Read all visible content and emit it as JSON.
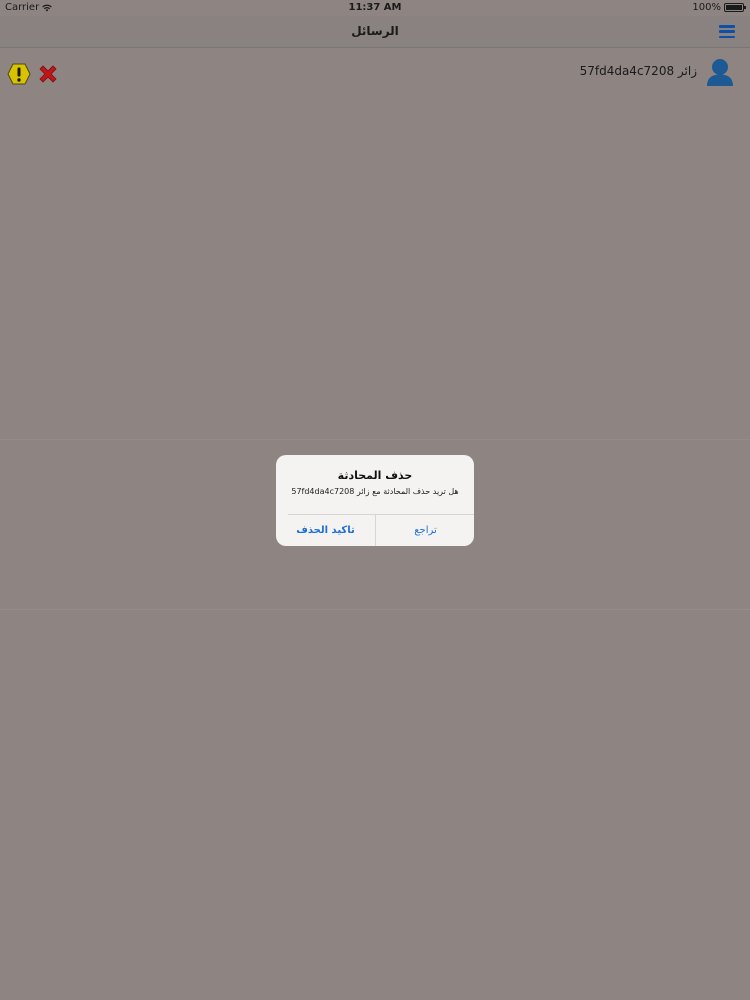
{
  "status_bar": {
    "carrier": "Carrier",
    "time": "11:37 AM",
    "battery": "100%"
  },
  "nav": {
    "title": "الرسائل",
    "menu_icon": "hamburger-menu-icon"
  },
  "conversations": [
    {
      "visitor": "زائر 57fd4da4c7208",
      "avatar_icon": "user-avatar-icon",
      "warn_icon": "warning-icon",
      "delete_icon": "delete-x-icon"
    }
  ],
  "alert": {
    "title": "حذف المحادثة",
    "message": "هل تريد حذف المحادثة مع زائر 57fd4da4c7208",
    "confirm_label": "تاكيد الحذف",
    "cancel_label": "تراجع"
  },
  "colors": {
    "overlay_bg": "#8e8583",
    "accent": "#1c6fd9",
    "menu_icon": "#0e4fa8",
    "warning": "#d9c200",
    "delete": "#c0161a"
  }
}
